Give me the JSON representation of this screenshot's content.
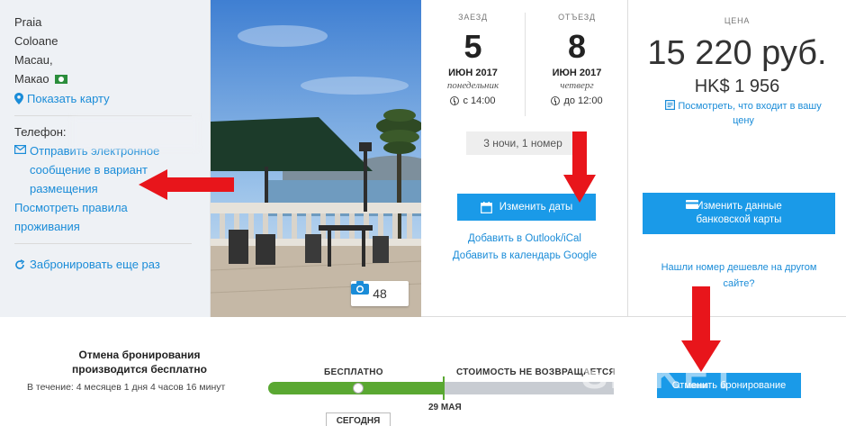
{
  "hotel": {
    "address_lines": [
      "Praia",
      "Coloane",
      "Macau,",
      "Макао"
    ],
    "show_map": "Показать карту",
    "phone_label": "Телефон:",
    "email_link": "Отправить электронное сообщение в вариант размещения",
    "rules_link": "Посмотреть правила проживания",
    "rebook_link": "Забронировать еще раз"
  },
  "photo": {
    "count": "48"
  },
  "dates": {
    "checkin": {
      "label": "ЗАЕЗД",
      "day": "5",
      "month": "ИЮН 2017",
      "weekday": "понедельник",
      "time": "с 14:00"
    },
    "checkout": {
      "label": "ОТЪЕЗД",
      "day": "8",
      "month": "ИЮН 2017",
      "weekday": "четверг",
      "time": "до 12:00"
    },
    "nights": "3 ночи, 1 номер",
    "change_dates": "Изменить даты",
    "add_outlook": "Добавить в Outlook/iCal",
    "add_google": "Добавить в календарь Google"
  },
  "price": {
    "label": "ЦЕНА",
    "main": "15 220 руб.",
    "alt": "HK$ 1 956",
    "whats_included": "Посмотреть, что входит в вашу цену",
    "change_card": "Изменить данные банковской карты",
    "cheaper": "Нашли номер дешевле на другом сайте?"
  },
  "cancellation": {
    "title": "Отмена бронирования производится бесплатно",
    "period": "В течение: 4 месяцев 1 дня 4 часов 16 минут",
    "free_label": "БЕСПЛАТНО",
    "paid_label": "СТОИМОСТЬ НЕ ВОЗВРАЩАЕТСЯ",
    "date_label": "29 МАЯ",
    "today_label": "СЕГОДНЯ",
    "cancel_button": "Отменить бронирование"
  },
  "watermark": "SICKET",
  "colors": {
    "accent": "#1a9ae8",
    "link": "#1a8cd8",
    "free_bar": "#5aa832",
    "arrow": "#e8151b"
  }
}
